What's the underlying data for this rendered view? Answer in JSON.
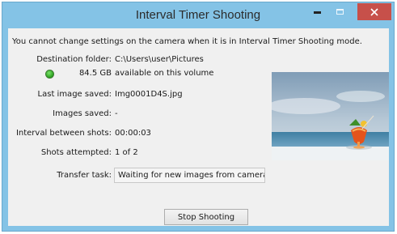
{
  "window": {
    "title": "Interval Timer Shooting",
    "close_color": "#c7504a",
    "frame_color": "#84c3e6"
  },
  "message": "You cannot change settings on the camera when it is in Interval Timer Shooting mode.",
  "fields": {
    "destination_label": "Destination folder:",
    "destination_value": "C:\\Users\\user\\Pictures",
    "free_space": "84.5 GB",
    "free_space_suffix": "available on this volume",
    "last_image_label": "Last image saved:",
    "last_image_value": "Img0001D4S.jpg",
    "images_saved_label": "Images saved:",
    "images_saved_value": "-",
    "interval_label": "Interval between shots:",
    "interval_value": "00:00:03",
    "shots_label": "Shots attempted:",
    "shots_value": "1 of 2",
    "transfer_label": "Transfer task:",
    "transfer_value": "Waiting for new images from camera..."
  },
  "status_icon": "green-status-icon",
  "buttons": {
    "stop_label": "Stop Shooting"
  }
}
